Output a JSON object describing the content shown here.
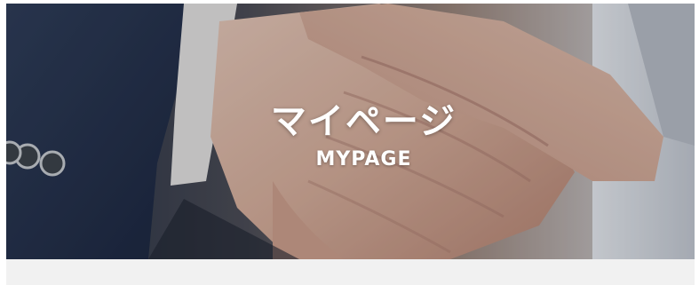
{
  "hero": {
    "title": "マイページ",
    "subtitle": "MYPAGE",
    "image_description": "handshake-photo",
    "overlay_color": "#141c28"
  },
  "content": {
    "background_color": "#f1f1f1"
  }
}
